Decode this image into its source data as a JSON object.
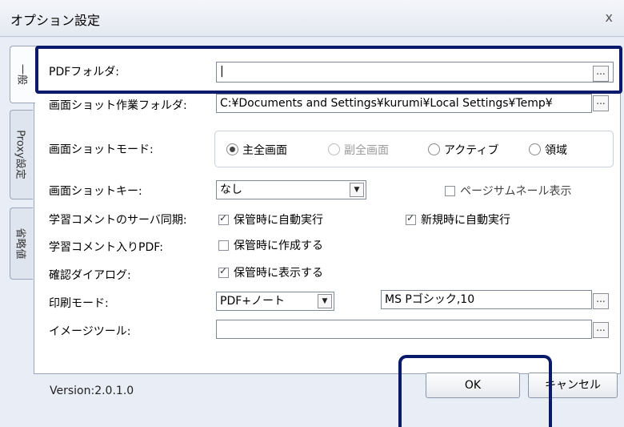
{
  "window": {
    "title": "オプション設定",
    "close_glyph": "x"
  },
  "tabs": [
    {
      "label": "一般",
      "active": true
    },
    {
      "label": "Proxy設定",
      "active": false
    },
    {
      "label": "省略値",
      "active": false
    }
  ],
  "form": {
    "pdf_folder": {
      "label": "PDFフォルダ:",
      "value": "|"
    },
    "screenshot_folder": {
      "label": "画面ショット作業フォルダ:",
      "value": "C:¥Documents and Settings¥kurumi¥Local Settings¥Temp¥"
    },
    "screenshot_mode": {
      "label": "画面ショットモード:",
      "options": [
        {
          "label": "主全画面",
          "selected": true,
          "disabled": false
        },
        {
          "label": "副全画面",
          "selected": false,
          "disabled": true
        },
        {
          "label": "アクティブ",
          "selected": false,
          "disabled": false
        },
        {
          "label": "領域",
          "selected": false,
          "disabled": false
        }
      ]
    },
    "screenshot_key": {
      "label": "画面ショットキー:",
      "value": "なし"
    },
    "page_thumbnail": {
      "label": "ページサムネール表示",
      "checked": false
    },
    "server_sync": {
      "label": "学習コメントのサーバ同期:",
      "save_auto": {
        "label": "保管時に自動実行",
        "checked": true
      },
      "new_auto": {
        "label": "新規時に自動実行",
        "checked": true
      }
    },
    "comment_pdf": {
      "label": "学習コメント入りPDF:",
      "create_on_save": {
        "label": "保管時に作成する",
        "checked": false
      }
    },
    "confirm_dialog": {
      "label": "確認ダイアログ:",
      "show_on_save": {
        "label": "保管時に表示する",
        "checked": true
      }
    },
    "print_mode": {
      "label": "印刷モード:",
      "value": "PDF+ノート",
      "font": "MS Pゴシック,10"
    },
    "image_tool": {
      "label": "イメージツール:",
      "value": ""
    }
  },
  "footer": {
    "version": "Version:2.0.1.0",
    "ok_label": "OK",
    "cancel_label": "キャンセル"
  },
  "icons": {
    "browse_glyph": "...",
    "dropdown_glyph": "▼"
  },
  "colors": {
    "highlight": "#0a1a6b",
    "dialog_bg": "#e9eef6"
  }
}
